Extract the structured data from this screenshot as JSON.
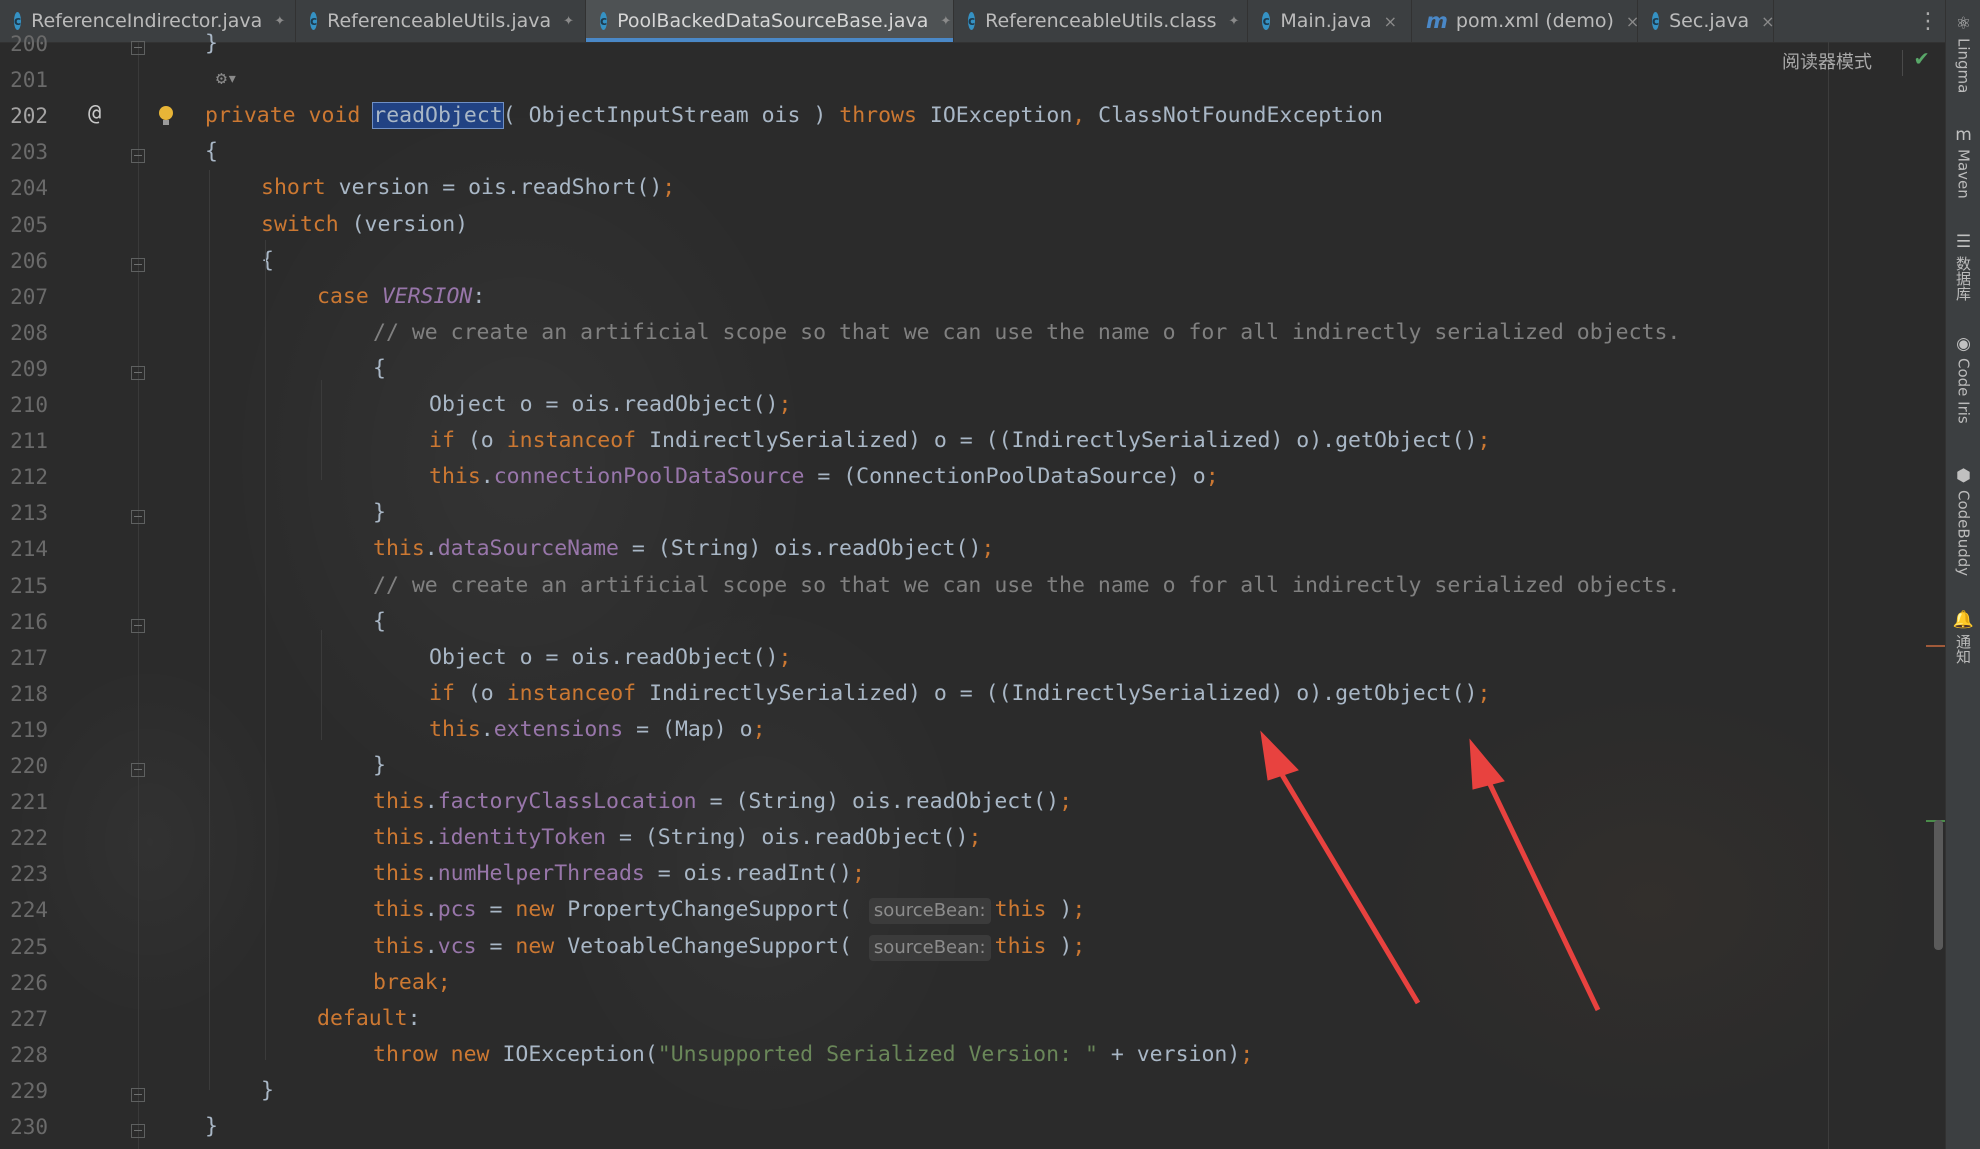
{
  "tabs": [
    {
      "label": "ReferenceIndirector.java",
      "icon": "java-class-icon",
      "pinned": true
    },
    {
      "label": "ReferenceableUtils.java",
      "icon": "java-class-icon",
      "pinned": true
    },
    {
      "label": "PoolBackedDataSourceBase.java",
      "icon": "java-class-icon",
      "pinned": true,
      "active": true
    },
    {
      "label": "ReferenceableUtils.class",
      "icon": "java-class-icon",
      "pinned": true
    },
    {
      "label": "Main.java",
      "icon": "java-class-icon",
      "closable": true
    },
    {
      "label": "pom.xml (demo)",
      "icon": "maven-icon",
      "closable": true
    },
    {
      "label": "Sec.java",
      "icon": "java-class-icon",
      "closable": true
    }
  ],
  "tab_menu_glyph": "⋮",
  "pin_glyph": "📌",
  "close_glyph": "×",
  "reader_mode": "阅读器模式",
  "right_tools": [
    "Lingma",
    "Maven",
    "数据库",
    "Code Iris",
    "CodeBuddy",
    "通知"
  ],
  "gutter": {
    "line_numbers": [
      "200",
      "201",
      "202",
      "203",
      "204",
      "205",
      "206",
      "207",
      "208",
      "209",
      "210",
      "211",
      "212",
      "213",
      "214",
      "215",
      "216",
      "217",
      "218",
      "219",
      "220",
      "221",
      "222",
      "223",
      "224",
      "225",
      "226",
      "227",
      "228",
      "229",
      "230"
    ],
    "current_line": "202",
    "override_marker": "@"
  },
  "code_lines": [
    {
      "n": "200",
      "indent": 0,
      "html": "}"
    },
    {
      "n": "201",
      "indent": 0,
      "html": ""
    },
    {
      "n": "202",
      "indent": 0,
      "html": "<span class=\"kw\">private void </span><span class=\"sel\">readObject</span>( ObjectInputStream ois ) <span class=\"kw\">throws </span>IOException<span class=\"kw\">, </span>ClassNotFoundException"
    },
    {
      "n": "203",
      "indent": 0,
      "html": "{"
    },
    {
      "n": "204",
      "indent": 1,
      "html": "<span class=\"kw\">short </span>version = ois.readShort()<span class=\"kw\">;</span>"
    },
    {
      "n": "205",
      "indent": 1,
      "html": "<span class=\"kw\">switch </span>(version)"
    },
    {
      "n": "206",
      "indent": 1,
      "html": "{"
    },
    {
      "n": "207",
      "indent": 2,
      "html": "<span class=\"kw\">case </span><span class=\"con\">VERSION</span>:"
    },
    {
      "n": "208",
      "indent": 3,
      "html": "<span class=\"cmt\">// we create an artificial scope so that we can use the name o for all indirectly serialized objects.</span>"
    },
    {
      "n": "209",
      "indent": 3,
      "html": "{"
    },
    {
      "n": "210",
      "indent": 4,
      "html": "Object o = ois.readObject()<span class=\"kw\">;</span>"
    },
    {
      "n": "211",
      "indent": 4,
      "html": "<span class=\"kw\">if </span>(o <span class=\"kw\">instanceof </span>IndirectlySerialized) o = ((IndirectlySerialized) o).getObject()<span class=\"kw\">;</span>"
    },
    {
      "n": "212",
      "indent": 4,
      "html": "<span class=\"kw\">this</span>.<span class=\"fld\">connectionPoolDataSource</span> = (ConnectionPoolDataSource) o<span class=\"kw\">;</span>"
    },
    {
      "n": "213",
      "indent": 3,
      "html": "}"
    },
    {
      "n": "214",
      "indent": 3,
      "html": "<span class=\"kw\">this</span>.<span class=\"fld\">dataSourceName</span> = (String) ois.readObject()<span class=\"kw\">;</span>"
    },
    {
      "n": "215",
      "indent": 3,
      "html": "<span class=\"cmt\">// we create an artificial scope so that we can use the name o for all indirectly serialized objects.</span>"
    },
    {
      "n": "216",
      "indent": 3,
      "html": "{"
    },
    {
      "n": "217",
      "indent": 4,
      "html": "Object o = ois.readObject()<span class=\"kw\">;</span>"
    },
    {
      "n": "218",
      "indent": 4,
      "html": "<span class=\"kw\">if </span>(o <span class=\"kw\">instanceof </span>IndirectlySerialized) o = ((IndirectlySerialized) o).getObject()<span class=\"kw\">;</span>"
    },
    {
      "n": "219",
      "indent": 4,
      "html": "<span class=\"kw\">this</span>.<span class=\"fld\">extensions</span> = (Map) o<span class=\"kw\">;</span>"
    },
    {
      "n": "220",
      "indent": 3,
      "html": "}"
    },
    {
      "n": "221",
      "indent": 3,
      "html": "<span class=\"kw\">this</span>.<span class=\"fld\">factoryClassLocation</span> = (String) ois.readObject()<span class=\"kw\">;</span>"
    },
    {
      "n": "222",
      "indent": 3,
      "html": "<span class=\"kw\">this</span>.<span class=\"fld\">identityToken</span> = (String) ois.readObject()<span class=\"kw\">;</span>"
    },
    {
      "n": "223",
      "indent": 3,
      "html": "<span class=\"kw\">this</span>.<span class=\"fld\">numHelperThreads</span> = ois.readInt()<span class=\"kw\">;</span>"
    },
    {
      "n": "224",
      "indent": 3,
      "html": "<span class=\"kw\">this</span>.<span class=\"fld\">pcs</span> = <span class=\"kw\">new </span>PropertyChangeSupport( <span class=\"hint\">sourceBean:</span><span class=\"kw\">this </span>)<span class=\"kw\">;</span>"
    },
    {
      "n": "225",
      "indent": 3,
      "html": "<span class=\"kw\">this</span>.<span class=\"fld\">vcs</span> = <span class=\"kw\">new </span>VetoableChangeSupport( <span class=\"hint\">sourceBean:</span><span class=\"kw\">this </span>)<span class=\"kw\">;</span>"
    },
    {
      "n": "226",
      "indent": 3,
      "html": "<span class=\"kw\">break;</span>"
    },
    {
      "n": "227",
      "indent": 2,
      "html": "<span class=\"kw\">default</span>:"
    },
    {
      "n": "228",
      "indent": 3,
      "html": "<span class=\"kw\">throw new </span>IOException(<span class=\"str\">\"Unsupported Serialized Version: \"</span> + version)<span class=\"kw\">;</span>"
    },
    {
      "n": "229",
      "indent": 1,
      "html": "}"
    },
    {
      "n": "230",
      "indent": 0,
      "html": "}"
    }
  ],
  "colors": {
    "keyword": "#cc7832",
    "field": "#9876aa",
    "comment": "#808080",
    "string": "#6a8759",
    "text": "#a9b7c6",
    "selection": "#214283",
    "annotation_arrow": "#e8423f"
  }
}
